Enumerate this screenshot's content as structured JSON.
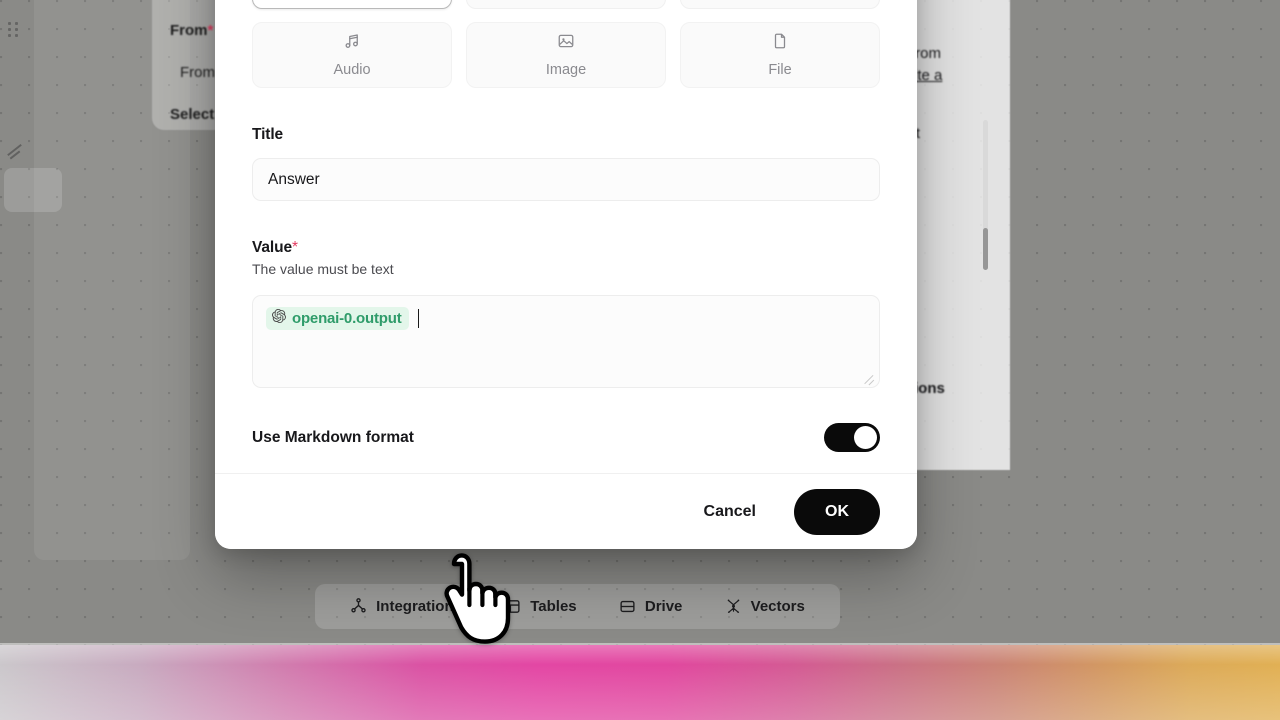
{
  "modal": {
    "type_options_row1": [
      {
        "label": "",
        "name": "type-card-selected",
        "selected": true
      },
      {
        "label": "",
        "name": "type-card-2",
        "selected": false
      },
      {
        "label": "",
        "name": "type-card-3",
        "selected": false
      }
    ],
    "type_options_row2": [
      {
        "label": "Audio",
        "icon": "music-note-icon"
      },
      {
        "label": "Image",
        "icon": "image-icon"
      },
      {
        "label": "File",
        "icon": "file-icon"
      }
    ],
    "title_field": {
      "label": "Title",
      "value": "Answer",
      "placeholder": "Title"
    },
    "value_field": {
      "label": "Value",
      "required_marker": "*",
      "hint": "The value must be text",
      "token": "openai-0.output",
      "token_icon": "openai-logo-icon",
      "token_bg": "#e3f6ea",
      "token_color": "#2f9c6a"
    },
    "markdown_toggle": {
      "label": "Use Markdown format",
      "state": "on"
    },
    "footer": {
      "cancel_label": "Cancel",
      "ok_label": "OK",
      "ok_bg": "#0a0a0a"
    }
  },
  "toolbar": {
    "items": [
      {
        "label": "Integrations",
        "icon": "integrations-icon"
      },
      {
        "label": "Tables",
        "icon": "tables-icon"
      },
      {
        "label": "Drive",
        "icon": "drive-icon"
      },
      {
        "label": "Vectors",
        "icon": "vectors-icon"
      }
    ]
  },
  "background": {
    "left_node": {
      "from_label": "From",
      "from_required": "*",
      "from_value": "From",
      "select_text": "Select"
    },
    "right_panel": {
      "line1": "from",
      "line2": "rite a",
      "line3": "'t",
      "line4": "tions"
    }
  },
  "colors": {
    "accent_required": "#e3395f",
    "token_green": "#2f9c6a",
    "button_black": "#0a0a0a"
  }
}
